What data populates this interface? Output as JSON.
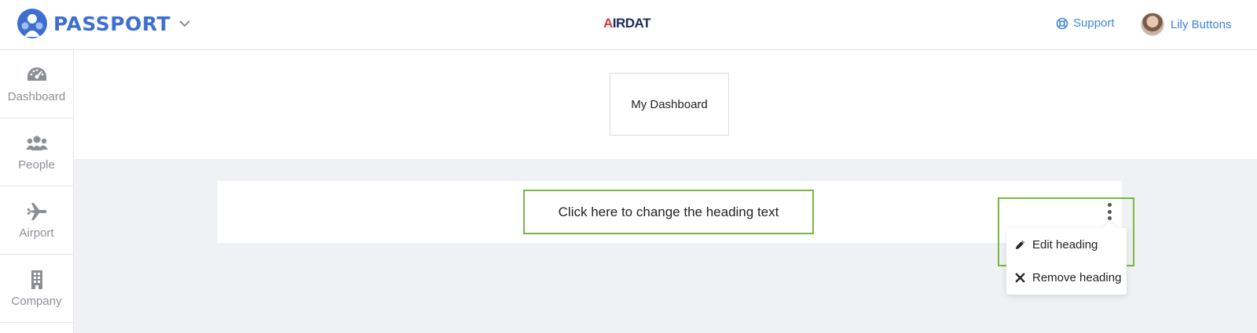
{
  "header": {
    "brand_name": "PASSPORT",
    "center_logo_a": "A",
    "center_logo_rest": "IRDAT",
    "support_label": "Support",
    "user_name": "Lily Buttons"
  },
  "sidebar": {
    "items": [
      {
        "label": "Dashboard",
        "icon": "dashboard-gauge-icon"
      },
      {
        "label": "People",
        "icon": "people-icon"
      },
      {
        "label": "Airport",
        "icon": "airplane-icon"
      },
      {
        "label": "Company",
        "icon": "building-icon"
      }
    ]
  },
  "main": {
    "dashboard_title": "My Dashboard",
    "heading_text": "Click here to change the heading text",
    "menu": {
      "edit_label": "Edit heading",
      "remove_label": "Remove heading"
    }
  },
  "colors": {
    "brand": "#3e6fd0",
    "link": "#3e86d8",
    "highlight": "#78b843",
    "sidebar_text": "#8b8f96",
    "background_gray": "#f0f1f4"
  }
}
